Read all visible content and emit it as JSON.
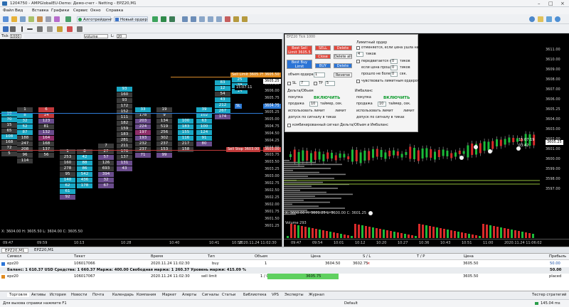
{
  "window": {
    "title": "1204750 - AMPGlobalEU-Demo: Демо-счет - Netting - EPZ20,M1"
  },
  "menu": [
    "Файл",
    "Вид",
    "Вставка",
    "Графики",
    "Сервис",
    "Окно",
    "Справка"
  ],
  "toolbar": {
    "algo_label": "Алготрейдинг",
    "new_order_label": "Новый ордер"
  },
  "chart_left": {
    "tab": "EPZ20,M1",
    "header": {
      "tick_label": "Tick",
      "tick_value": "1000",
      "volume_select": "volume",
      "last_label": "L:",
      "l_value": "20"
    },
    "prices": [
      "3606.50",
      "3606.25",
      "3606.00",
      "3605.75",
      "3605.50",
      "3605.25",
      "3605.00",
      "3604.75",
      "3604.50",
      "3604.25",
      "3604.00",
      "3603.75",
      "3603.50",
      "3603.25",
      "3603.00",
      "3602.75",
      "3602.50",
      "3602.25",
      "3602.00",
      "3601.75",
      "3601.50",
      "3601.25"
    ],
    "price_labels": {
      "sell_limit": "Sell Limit  3605.75",
      "current": "3605.50",
      "time": "15:07:11",
      "ask": "3605.25",
      "buy_limit": "3604.75",
      "stop": "3603.00"
    },
    "side_badge": {
      "sl": "SL",
      "buy": "Buy Limit 3604.50",
      "sell": "Sell Stop 3603.00"
    },
    "footer": {
      "x_coord": "X: 3604.00 H: 3605.50 L: 3604.00 C: 3605.50"
    },
    "time_axis": [
      "09:47",
      "09:59",
      "10:13",
      "10:28",
      "10:40",
      "10:41",
      "10:58",
      "2020.11.24 11:02:30"
    ]
  },
  "chart_right": {
    "tab": "EPZ20 Tick  1000",
    "prices": [
      "3611.00",
      "3610.00",
      "3609.00",
      "3608.00",
      "3607.00",
      "3606.00",
      "3605.25",
      "3604.00",
      "3603.00",
      "3602.00",
      "3601.00",
      "3600.00",
      "3599.00",
      "3598.00",
      "3597.00"
    ],
    "time_label": "15:07:19",
    "cur_price": "3605.25",
    "cur_label2": "03:42",
    "footer": "X: 3600.00 H: 3601.25 L: 3600.00 C: 3601.25",
    "volume_label": "Volume  293",
    "time_axis": [
      "09:47",
      "09:54",
      "10:01",
      "10:12",
      "10:20",
      "10:27",
      "10:36",
      "10:43",
      "10:51",
      "11:00",
      "2020.11.24 11:06:02"
    ]
  },
  "dialog": {
    "best_sell": "Best Sell\nLimit 3605.5",
    "sell": "SELL",
    "delete": "Delete",
    "close": "Close",
    "delete_all": "Delete all",
    "best_buy": "Best Buy\nLimit 3605.25",
    "buy": "BUY",
    "delete2": "Delete",
    "reverse": "Reverse",
    "volume_label": "объем ордера",
    "volume_value": "1",
    "sl_label": "SL",
    "sl_value": "7",
    "tp_label": "TP",
    "tp_value": "5",
    "delta_label": "Дельта/Объем",
    "imbalance_label": "Имбаланс",
    "buy_radio": "покупка",
    "sell_radio": "продажа",
    "enable": "ВКЛЮЧИТЬ",
    "timer_label": "таймер, сек.",
    "timer_value": "10",
    "use_label": "использовать лимит",
    "limit_label": "лимит",
    "allow_label": "допуск по сигналу в тиках",
    "combined_label": "комбинированный сигнал Дельта/Объем и Имбаланс",
    "trailing_title": "Лимитный ордер",
    "trailing_1": "отменяется, если цена ушла на",
    "trailing_1v": "4",
    "trailing_ticks": "тиков",
    "trailing_2": "передвигается на",
    "trailing_2v": "0",
    "trailing_3": "если цена прошла",
    "trailing_3v": "0",
    "trailing_4": "прошло не более",
    "trailing_4v": "0",
    "trailing_sec": "сек.",
    "trailing_check": "чувствовать лимитным ордером",
    "ticks_word": "тиков"
  },
  "chart_tabs": [
    "EPZ20,M1",
    "EPZ20,M1"
  ],
  "terminal": {
    "headers": [
      "Символ",
      "Тикет",
      "Время",
      "Тип",
      "Объем",
      "Цена",
      "S / L",
      "T / P",
      "Цена",
      "Прибыль"
    ],
    "rows": [
      {
        "symbol": "epz20",
        "ticket": "106017066",
        "time": "2020.11.24 11:02:30",
        "type": "buy",
        "volume": "1",
        "price": "3604.50",
        "sl": "3602.75",
        "tp": "",
        "cur": "3605.50",
        "profit": "50.00"
      },
      {
        "balance": "Баланс: 1 610.37 USD  Средства: 1 660.37  Маржа: 400.00  Свободная маржа: 1 260.37  Уровень маржи: 415.09 %",
        "profit": "50.00"
      },
      {
        "symbol": "epz20",
        "ticket": "106017067",
        "time": "2020.11.24 11:02:30",
        "type": "sell limit",
        "volume": "1 / 0",
        "price": "3605.75",
        "sl": "",
        "tp": "",
        "cur": "3605.50",
        "profit": "placed"
      }
    ]
  },
  "bottom_tabs": [
    "Торговля",
    "Активы",
    "История",
    "Новости",
    "Почта",
    "Календарь",
    "Компания",
    "Маркет",
    "Алерты",
    "Сигналы",
    "Статьи",
    "Библиотека",
    "VPS",
    "Эксперты",
    "Журнал"
  ],
  "tester": "Тестер стратегий",
  "status": {
    "help": "Для вызова справки нажмите F1",
    "profile": "Default",
    "net": "145.04 ms"
  }
}
